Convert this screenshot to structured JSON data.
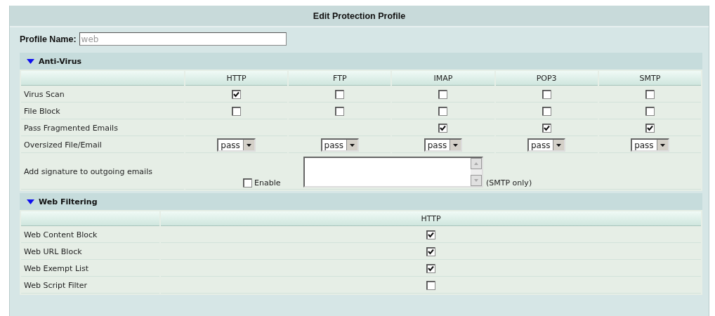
{
  "title": "Edit Protection Profile",
  "profile_name": {
    "label": "Profile Name:",
    "value": "web",
    "disabled": true
  },
  "sections": [
    {
      "title": "Anti-Virus",
      "expanded": true,
      "columns": [
        "HTTP",
        "FTP",
        "IMAP",
        "POP3",
        "SMTP"
      ],
      "rows": [
        {
          "label": "Virus Scan",
          "kind": "checkboxes",
          "cells": [
            {
              "kind": "checkbox",
              "checked": true
            },
            {
              "kind": "checkbox",
              "checked": false
            },
            {
              "kind": "checkbox",
              "checked": false
            },
            {
              "kind": "checkbox",
              "checked": false
            },
            {
              "kind": "checkbox",
              "checked": false
            }
          ]
        },
        {
          "label": "File Block",
          "kind": "checkboxes",
          "cells": [
            {
              "kind": "checkbox",
              "checked": false
            },
            {
              "kind": "checkbox",
              "checked": false
            },
            {
              "kind": "checkbox",
              "checked": false
            },
            {
              "kind": "checkbox",
              "checked": false
            },
            {
              "kind": "checkbox",
              "checked": false
            }
          ]
        },
        {
          "label": "Pass Fragmented Emails",
          "kind": "checkboxes",
          "cells": [
            {
              "kind": "blank"
            },
            {
              "kind": "blank"
            },
            {
              "kind": "checkbox",
              "checked": true
            },
            {
              "kind": "checkbox",
              "checked": true
            },
            {
              "kind": "checkbox",
              "checked": true
            }
          ]
        },
        {
          "label": "Oversized File/Email",
          "kind": "checkboxes",
          "cells": [
            {
              "kind": "select",
              "value": "pass"
            },
            {
              "kind": "select",
              "value": "pass"
            },
            {
              "kind": "select",
              "value": "pass"
            },
            {
              "kind": "select",
              "value": "pass"
            },
            {
              "kind": "select",
              "value": "pass"
            }
          ]
        },
        {
          "label": "Add signature to outgoing emails",
          "kind": "signature",
          "enable_label": "Enable",
          "checked": false,
          "note": "(SMTP only)"
        }
      ]
    },
    {
      "title": "Web Filtering",
      "expanded": true,
      "columns": [
        "HTTP"
      ],
      "rows": [
        {
          "label": "Web Content Block",
          "kind": "checkboxes",
          "cells": [
            {
              "kind": "checkbox",
              "checked": true
            }
          ]
        },
        {
          "label": "Web URL Block",
          "kind": "checkboxes",
          "cells": [
            {
              "kind": "checkbox",
              "checked": true
            }
          ]
        },
        {
          "label": "Web Exempt List",
          "kind": "checkboxes",
          "cells": [
            {
              "kind": "checkbox",
              "checked": true
            }
          ]
        },
        {
          "label": "Web Script Filter",
          "kind": "checkboxes",
          "cells": [
            {
              "kind": "checkbox",
              "checked": false
            }
          ]
        }
      ]
    }
  ]
}
